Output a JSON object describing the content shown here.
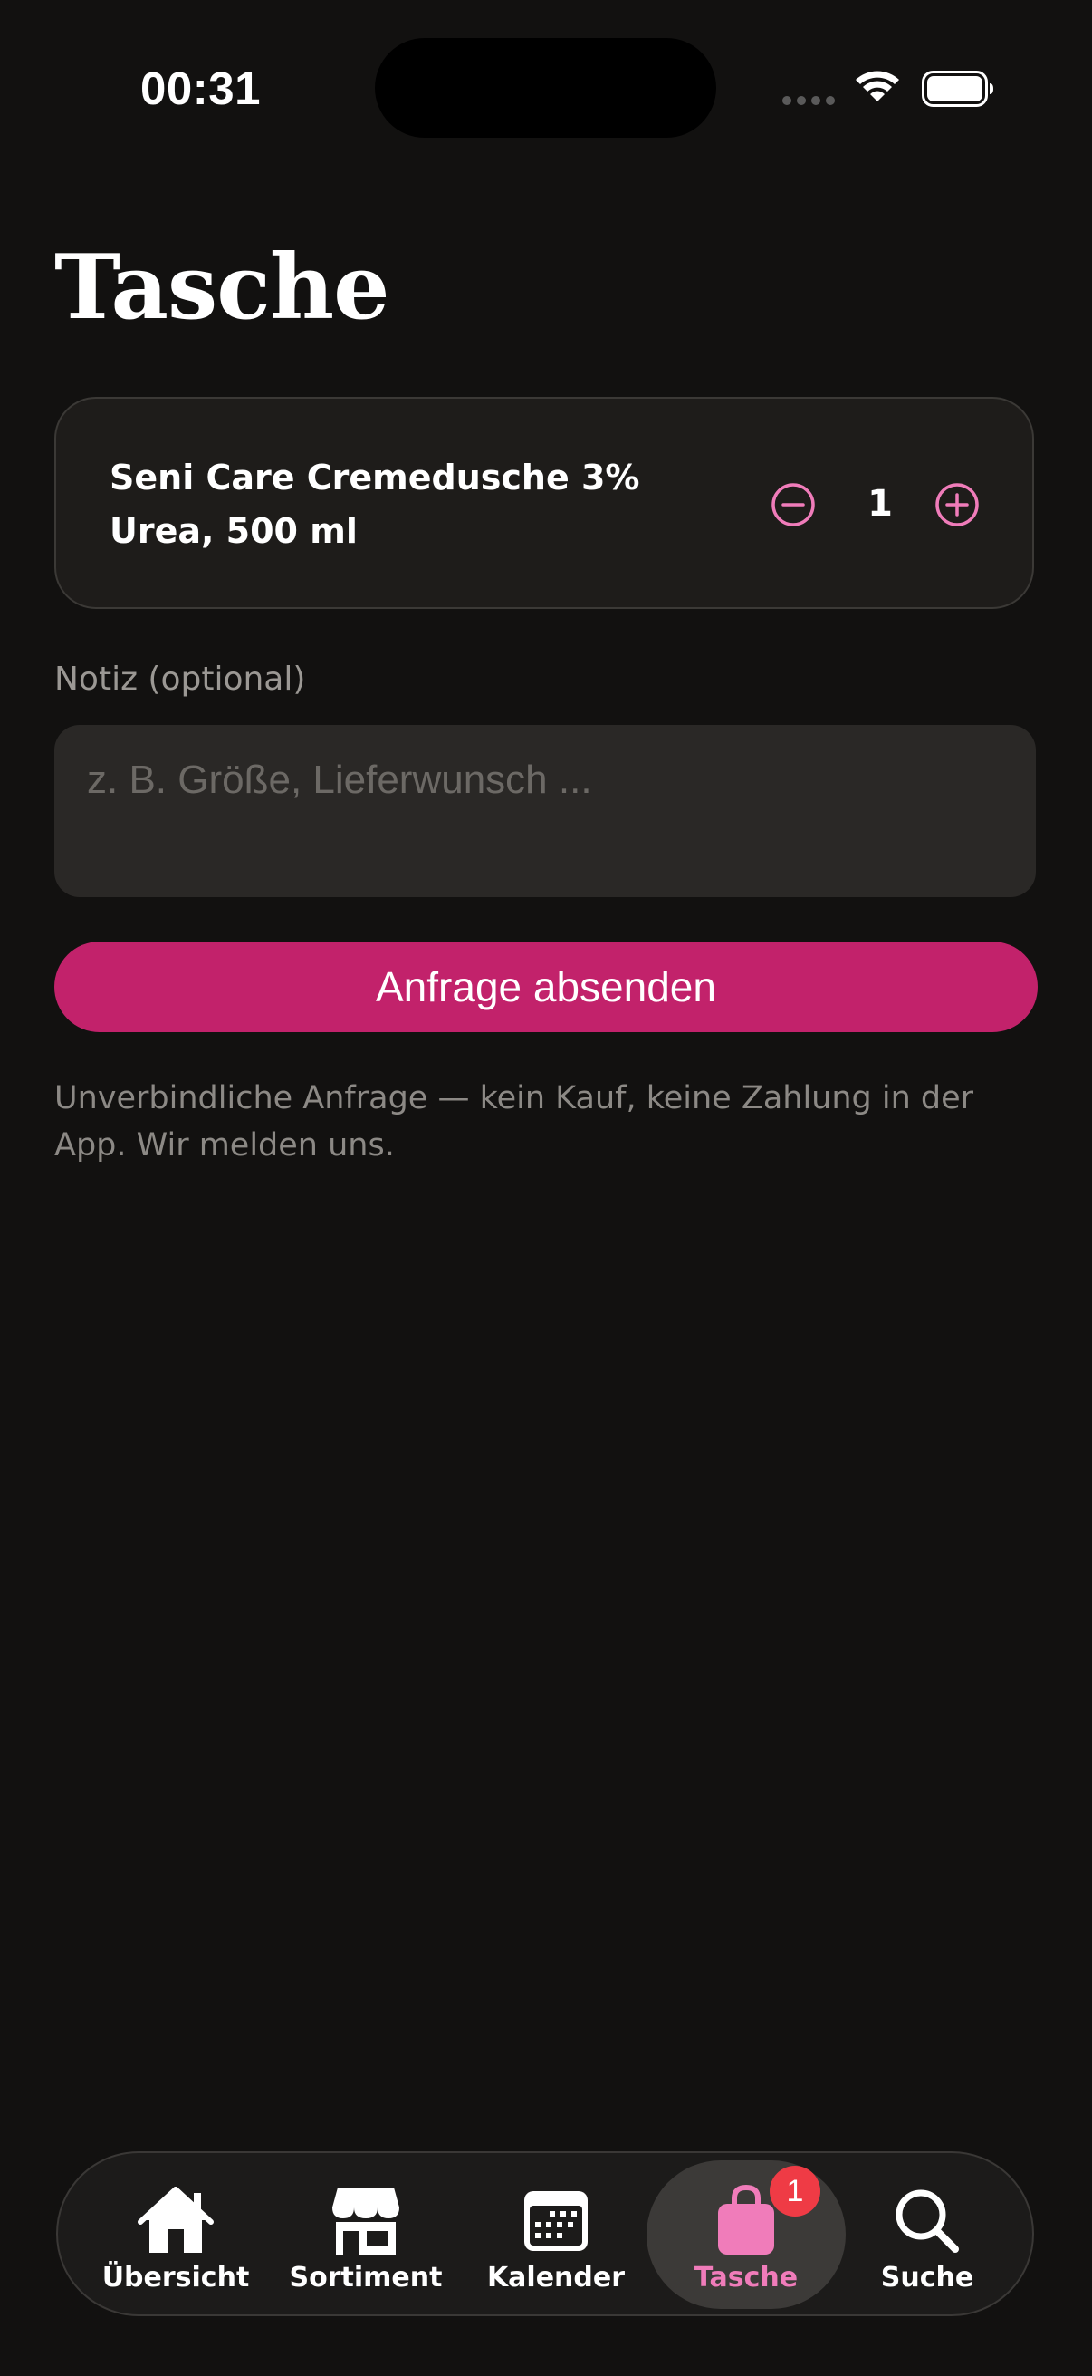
{
  "status_bar": {
    "time": "00:31"
  },
  "page": {
    "title": "Tasche"
  },
  "cart": {
    "items": [
      {
        "name": "Seni Care Cremedusche 3% Urea, 500 ml",
        "quantity": "1"
      }
    ]
  },
  "note": {
    "label": "Notiz (optional)",
    "placeholder": "z. B. Größe, Lieferwunsch ...",
    "value": ""
  },
  "submit": {
    "label": "Anfrage absenden"
  },
  "disclaimer": "Unverbindliche Anfrage — kein Kauf, keine Zahlung in der App. Wir melden uns.",
  "tab_bar": {
    "tabs": [
      {
        "label": "Übersicht",
        "icon": "house-icon"
      },
      {
        "label": "Sortiment",
        "icon": "storefront-icon"
      },
      {
        "label": "Kalender",
        "icon": "calendar-icon"
      },
      {
        "label": "Tasche",
        "icon": "bag-icon",
        "active": true,
        "badge": "1"
      },
      {
        "label": "Suche",
        "icon": "search-icon"
      }
    ]
  },
  "colors": {
    "background": "#121110",
    "accent": "#c2226b",
    "accent_light": "#f07cba",
    "badge": "#ef3b45"
  }
}
